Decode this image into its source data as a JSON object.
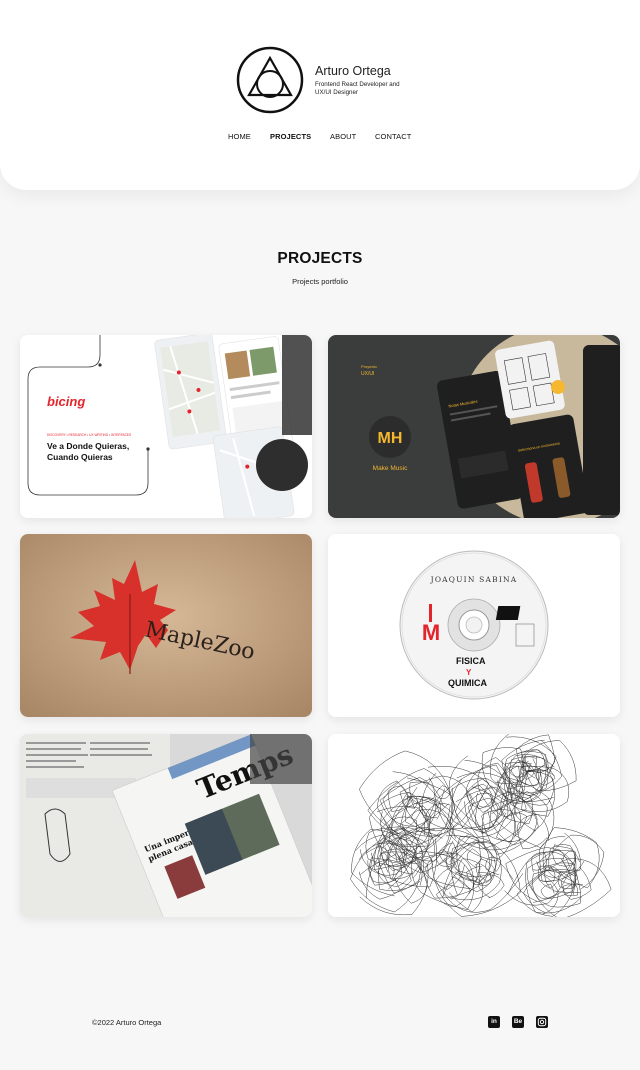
{
  "brand": {
    "name": "Arturo Ortega",
    "tagline": "Frontend React Developer and UX/UI Designer"
  },
  "nav": {
    "items": [
      "HOME",
      "PROJECTS",
      "ABOUT",
      "CONTACT"
    ],
    "active": "PROJECTS"
  },
  "section": {
    "title": "PROJECTS",
    "subtitle": "Projects portfolio"
  },
  "projects": [
    {
      "name": "bicing",
      "logo_text": "bicing",
      "headline_1": "Ve a Donde Quieras,",
      "headline_2": "Cuando Quieras",
      "tags": "DISCOVERY • RESEARCH • UX WRITING • INTERFACES"
    },
    {
      "name": "Make Music",
      "label": "Make Music",
      "project_label": "Proyecto",
      "project_type": "UX/UI",
      "screen_texts": [
        "Notas Musicales",
        "Selecciona un instrumento"
      ]
    },
    {
      "name": "MapleZoo",
      "label": "MapleZoo"
    },
    {
      "name": "Joaquin Sabina Fisica y Quimica",
      "artist": "JOAQUIN SABINA",
      "album_1": "FISICA",
      "album_2": "QUIMICA",
      "mark": "Y"
    },
    {
      "name": "Temps newspaper",
      "masthead": "Temps",
      "headline_1": "Una impertinencia en",
      "headline_2": "plena casa"
    },
    {
      "name": "Scribble portrait"
    }
  ],
  "footer": {
    "copyright": "©2022 Arturo Ortega",
    "social": [
      {
        "icon": "linkedin-icon",
        "text": "in"
      },
      {
        "icon": "behance-icon",
        "text": "Be"
      },
      {
        "icon": "instagram-icon",
        "text": ""
      }
    ]
  },
  "colors": {
    "accent_red": "#e3242b",
    "music_yellow": "#f5b82e",
    "music_bg": "#3b3c3c"
  }
}
